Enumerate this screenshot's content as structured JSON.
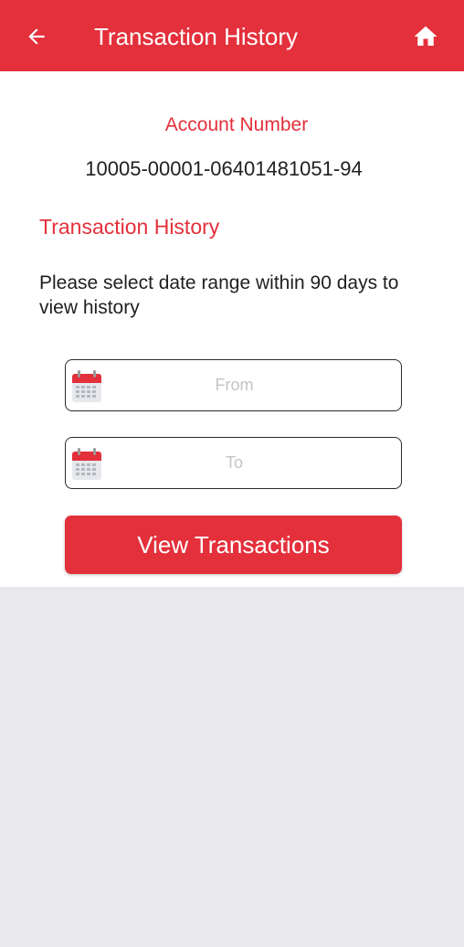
{
  "header": {
    "title": "Transaction History",
    "back_icon": "arrow-left-icon",
    "home_icon": "home-icon"
  },
  "account": {
    "label": "Account Number",
    "number": "10005-00001-06401481051-94"
  },
  "section": {
    "title": "Transaction History",
    "instruction": "Please select date range within 90 days to view history"
  },
  "from_field": {
    "placeholder": "From",
    "icon": "calendar-icon"
  },
  "to_field": {
    "placeholder": "To",
    "icon": "calendar-icon"
  },
  "view_button": {
    "label": "View Transactions"
  },
  "colors": {
    "accent": "#e3303b",
    "background": "#e9e9ed"
  }
}
